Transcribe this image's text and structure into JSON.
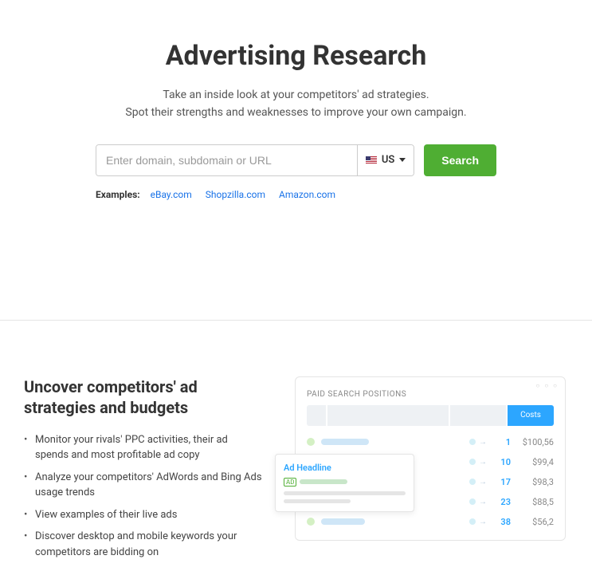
{
  "hero": {
    "title": "Advertising Research",
    "subtitle_line1": "Take an inside look at your competitors' ad strategies.",
    "subtitle_line2": "Spot their strengths and weaknesses to improve your own campaign."
  },
  "search": {
    "placeholder": "Enter domain, subdomain or URL",
    "region": "US",
    "button": "Search"
  },
  "examples": {
    "label": "Examples:",
    "items": [
      "eBay.com",
      "Shopzilla.com",
      "Amazon.com"
    ]
  },
  "feature": {
    "heading": "Uncover competitors' ad strategies and budgets",
    "bullets": [
      "Monitor your rivals' PPC activities, their ad spends and most profitable ad copy",
      "Analyze your competitors' AdWords and Bing Ads usage trends",
      "View examples of their live ads",
      "Discover desktop and mobile keywords your competitors are bidding on"
    ]
  },
  "illus": {
    "title": "PAID SEARCH POSITIONS",
    "costs_label": "Costs",
    "rows": [
      {
        "pos": "1",
        "cost": "$100,56",
        "bar": 60
      },
      {
        "pos": "10",
        "cost": "$99,4",
        "bar": 90
      },
      {
        "pos": "17",
        "cost": "$98,3",
        "bar": 110
      },
      {
        "pos": "23",
        "cost": "$88,5",
        "bar": 75
      },
      {
        "pos": "38",
        "cost": "$56,2",
        "bar": 55
      }
    ],
    "ad_card": {
      "headline": "Ad Headline",
      "badge": "AD"
    }
  }
}
